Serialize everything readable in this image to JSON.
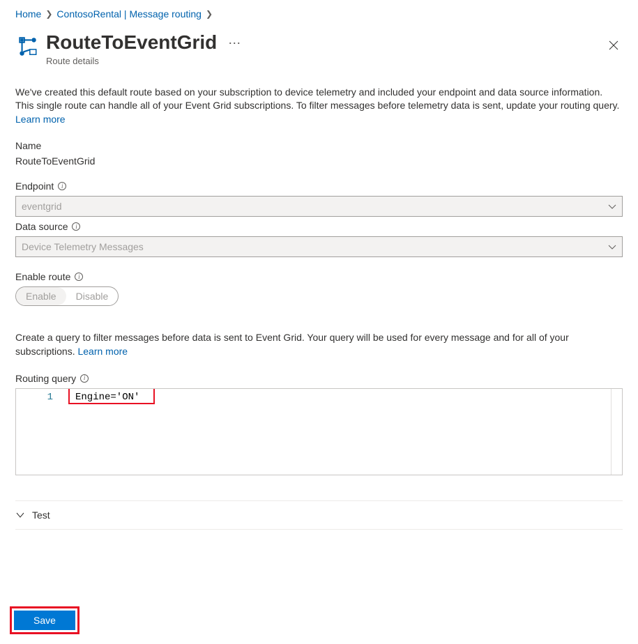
{
  "breadcrumbs": {
    "home": "Home",
    "parent": "ContosoRental | Message routing"
  },
  "header": {
    "title": "RouteToEventGrid",
    "subtitle": "Route details"
  },
  "intro": {
    "text": "We've created this default route based on your subscription to device telemetry and included your endpoint and data source information. This single route can handle all of your Event Grid subscriptions. To filter messages before telemetry data is sent, update your routing query. ",
    "learn_more": "Learn more"
  },
  "fields": {
    "name_label": "Name",
    "name_value": "RouteToEventGrid",
    "endpoint_label": "Endpoint",
    "endpoint_value": "eventgrid",
    "datasource_label": "Data source",
    "datasource_value": "Device Telemetry Messages",
    "enable_label": "Enable route",
    "enable_option_enable": "Enable",
    "enable_option_disable": "Disable"
  },
  "query": {
    "desc_text": "Create a query to filter messages before data is sent to Event Grid. Your query will be used for every message and for all of your subscriptions. ",
    "learn_more": "Learn more",
    "label": "Routing query",
    "line_number": "1",
    "code": "Engine='ON'"
  },
  "test": {
    "label": "Test"
  },
  "footer": {
    "save": "Save"
  }
}
